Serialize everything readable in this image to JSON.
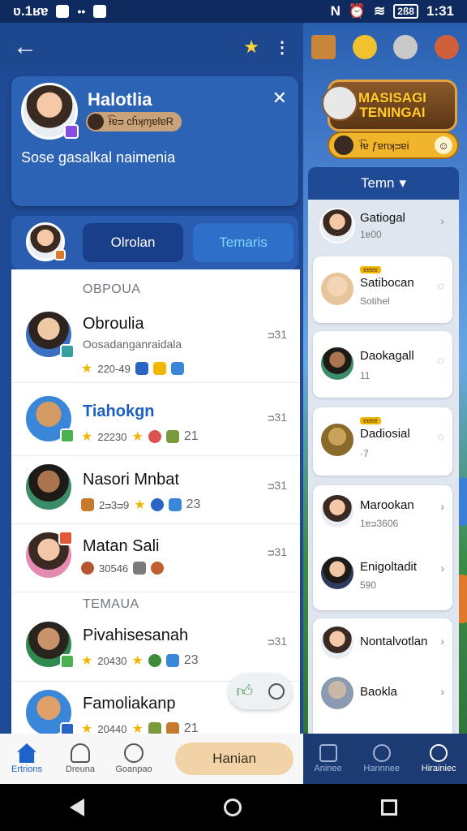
{
  "status_bar": {
    "time": "ʋ.1ʁɐ",
    "right_time": "1:31",
    "battery": "2ß8"
  },
  "top_bar": {},
  "profile": {
    "name": "Halotlia",
    "chip_label": "Ɨ͡ɐᴝ cȟʞɱɐlɐR",
    "status_text": "Sose gasalkal naimenia"
  },
  "tabs": [
    {
      "label": "Olrolan"
    },
    {
      "label": "Temaris"
    }
  ],
  "sections": {
    "first": "OBPOUA",
    "second": "TEMAUA"
  },
  "conversations": [
    {
      "name": "Obroulia",
      "sub": "Oosadanganraidala",
      "meta": "220-49",
      "time": "ᴝ31"
    },
    {
      "name": "Tiahokgn",
      "meta": "22230",
      "count": "21",
      "time": "ᴝ31"
    },
    {
      "name": "Nasori Mnbat",
      "meta": "2ᴝ3ᴝ9",
      "count": "23",
      "time": "ᴝ31"
    },
    {
      "name": "Matan Sali",
      "meta": "30546",
      "time": "ᴝ31"
    },
    {
      "name": "Pivahisesanah",
      "meta": "20430",
      "count": "23",
      "time": "ᴝ31"
    },
    {
      "name": "Famoliakanp",
      "meta": "20440",
      "count": "21"
    }
  ],
  "bottom_nav": {
    "items": [
      {
        "label": "Ertrions"
      },
      {
        "label": "Dreuna"
      },
      {
        "label": "Goanpao"
      }
    ],
    "cta": "Hanian"
  },
  "right_panel": {
    "banner": "MASISAGI TENINGAI",
    "gold_pill_label": "Ɨ͡ɐ ƒɐnʞᴝɐi",
    "header": "Temn",
    "items": [
      {
        "name": "Gatiogal",
        "sub": "1ɐ00"
      },
      {
        "name": "Satibocan",
        "sub": "Sotihel",
        "badge": "ɐɐɐɐ"
      },
      {
        "name": "Daokagall",
        "sub": "11"
      },
      {
        "name": "Dadiosial",
        "sub": "·7",
        "badge": "ɐɐɐɐ"
      },
      {
        "name": "Marookan",
        "sub": "1ɐᴝ3606"
      },
      {
        "name": "Enigoltadit",
        "sub": "590"
      },
      {
        "name": "Nontalvotlan"
      },
      {
        "name": "Baokla"
      }
    ],
    "nav": [
      {
        "label": "Aninee"
      },
      {
        "label": "Hannnee"
      },
      {
        "label": "Hirainiec"
      }
    ]
  },
  "colors": {
    "primary": "#1f4a95",
    "accent_blue": "#1d63c9",
    "gold": "#f2b705",
    "cta": "#f2d3a8"
  }
}
